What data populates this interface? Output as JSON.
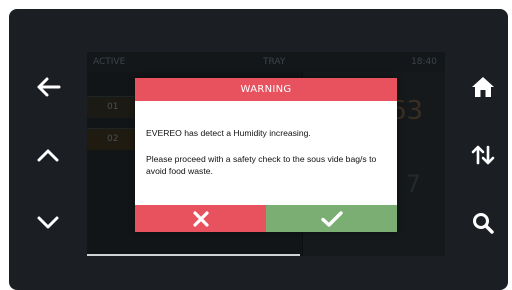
{
  "screen": {
    "header": {
      "left": "ACTIVE",
      "center": "TRAY",
      "right": "18:40"
    },
    "tray_rows": [
      "01",
      "02"
    ],
    "right_panel": {
      "big_value": "63",
      "small_value": "7"
    }
  },
  "dialog": {
    "title": "WARNING",
    "message_1": "EVEREO has detect a Humidity increasing.",
    "message_2": "Please proceed with a safety check to the sous vide bag/s to avoid food waste.",
    "cancel_icon": "close-icon",
    "confirm_icon": "check-icon"
  },
  "side_buttons": {
    "left": [
      "arrow-left-icon",
      "chevron-up-icon",
      "chevron-down-icon"
    ],
    "right": [
      "home-icon",
      "swap-vertical-icon",
      "search-icon"
    ]
  },
  "colors": {
    "device": "#1b1f24",
    "warning_red": "#e8525f",
    "confirm_green": "#7bae72",
    "icon_white": "#ffffff"
  }
}
